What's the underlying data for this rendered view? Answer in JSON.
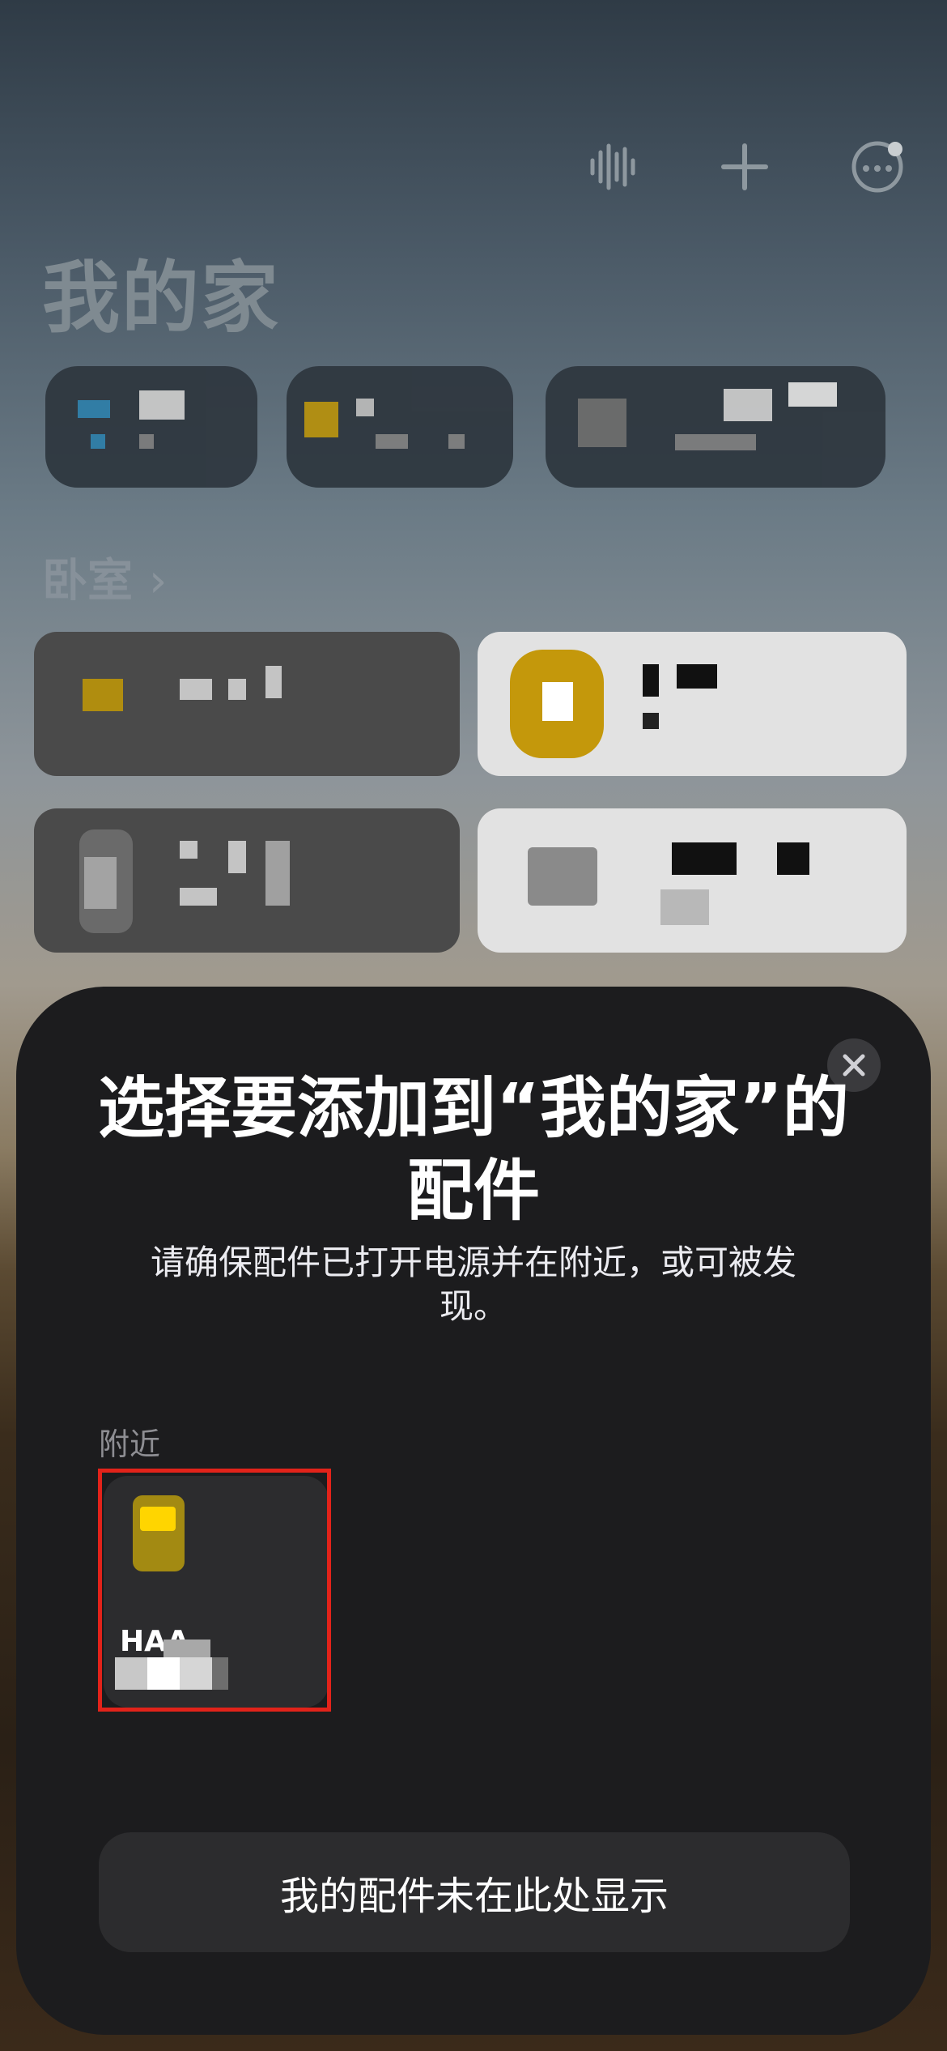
{
  "home": {
    "title": "我的家",
    "section_title": "卧室",
    "section_chevron": "›",
    "toolbar_icons": [
      "waveform-icon",
      "plus-icon",
      "more-icon"
    ]
  },
  "sheet": {
    "close_icon": "close-icon",
    "title": "选择要添加到“我的家”的配件",
    "subtitle": "请确保配件已打开电源并在附近，或可被发现。",
    "nearby_label": "附近",
    "accessory": {
      "name": "HAA-",
      "icon": "accessory-device-icon"
    },
    "not_shown_button": "我的配件未在此处显示"
  },
  "colors": {
    "sheet_bg": "#1c1c1e",
    "card_bg": "#2c2c2e",
    "highlight": "#e2231a",
    "accessory_icon": "#a38a12",
    "accessory_screen": "#ffd500"
  }
}
